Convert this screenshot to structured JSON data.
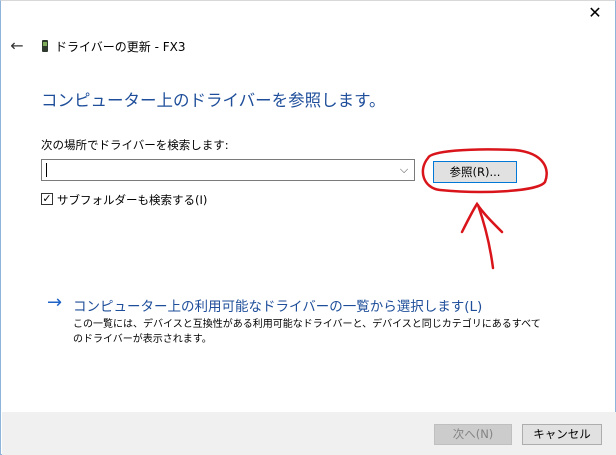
{
  "window": {
    "title": "ドライバーの更新 - FX3",
    "close_glyph": "✕",
    "back_glyph": "←"
  },
  "main": {
    "heading": "コンピューター上のドライバーを参照します。",
    "search_label": "次の場所でドライバーを検索します:",
    "path_value": "",
    "browse_button": "参照(R)...",
    "include_subfolders_label": "サブフォルダーも検索する(I)",
    "include_subfolders_checked": true
  },
  "pick_link": {
    "title": "コンピューター上の利用可能なドライバーの一覧から選択します(L)",
    "description": "この一覧には、デバイスと互換性がある利用可能なドライバーと、デバイスと同じカテゴリにあるすべてのドライバーが表示されます。"
  },
  "footer": {
    "next_button": "次へ(N)",
    "cancel_button": "キャンセル"
  },
  "colors": {
    "heading_blue": "#1e4e9a",
    "link_arrow_blue": "#1e63c7",
    "annotation_red": "#d9141a"
  },
  "icons": {
    "back": "back-arrow-icon",
    "device": "device-icon",
    "close": "close-icon",
    "dropdown": "chevron-down-icon",
    "link": "arrow-right-icon"
  }
}
